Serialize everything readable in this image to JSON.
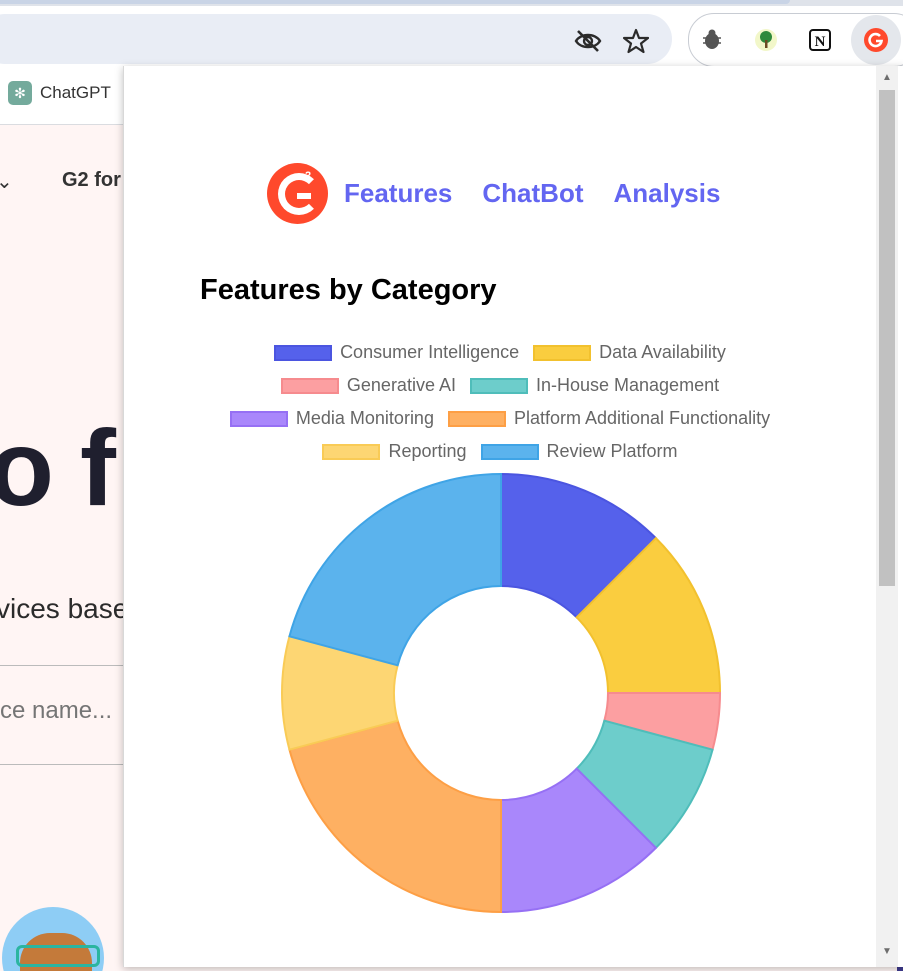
{
  "browser": {
    "bookmarks": [
      {
        "label": "ChatGPT"
      }
    ],
    "toolbar_icons": [
      "eye-off-icon",
      "star-icon"
    ],
    "extensions": [
      "bug-icon",
      "tree-icon",
      "notion-icon",
      "g2-icon"
    ]
  },
  "background_page": {
    "nav_text": "G2 for",
    "hero_fragment": "o f",
    "subtitle_fragment": "vices base",
    "search_placeholder": "ce name..."
  },
  "popup": {
    "nav": [
      {
        "label": "Features"
      },
      {
        "label": "ChatBot"
      },
      {
        "label": "Analysis"
      }
    ],
    "chart_title": "Features by Category"
  },
  "chart_data": {
    "type": "doughnut",
    "title": "Features by Category",
    "legend_position": "top",
    "series": [
      {
        "name": "Consumer Intelligence",
        "value": 3,
        "color": "#5561eb",
        "border": "#4b55e0"
      },
      {
        "name": "Data Availability",
        "value": 3,
        "color": "#facd3f",
        "border": "#f2c12e"
      },
      {
        "name": "Generative AI",
        "value": 1,
        "color": "#fc9fa1",
        "border": "#f68b8e"
      },
      {
        "name": "In-House Management",
        "value": 2,
        "color": "#6dcdcb",
        "border": "#4fbdba"
      },
      {
        "name": "Media Monitoring",
        "value": 3,
        "color": "#a987fb",
        "border": "#9670f4"
      },
      {
        "name": "Platform Additional Functionality",
        "value": 5,
        "color": "#feb062",
        "border": "#fd9f45"
      },
      {
        "name": "Reporting",
        "value": 2,
        "color": "#fdd673",
        "border": "#f9cb56"
      },
      {
        "name": "Review Platform",
        "value": 5,
        "color": "#5bb3ed",
        "border": "#3fa4e6"
      }
    ]
  }
}
